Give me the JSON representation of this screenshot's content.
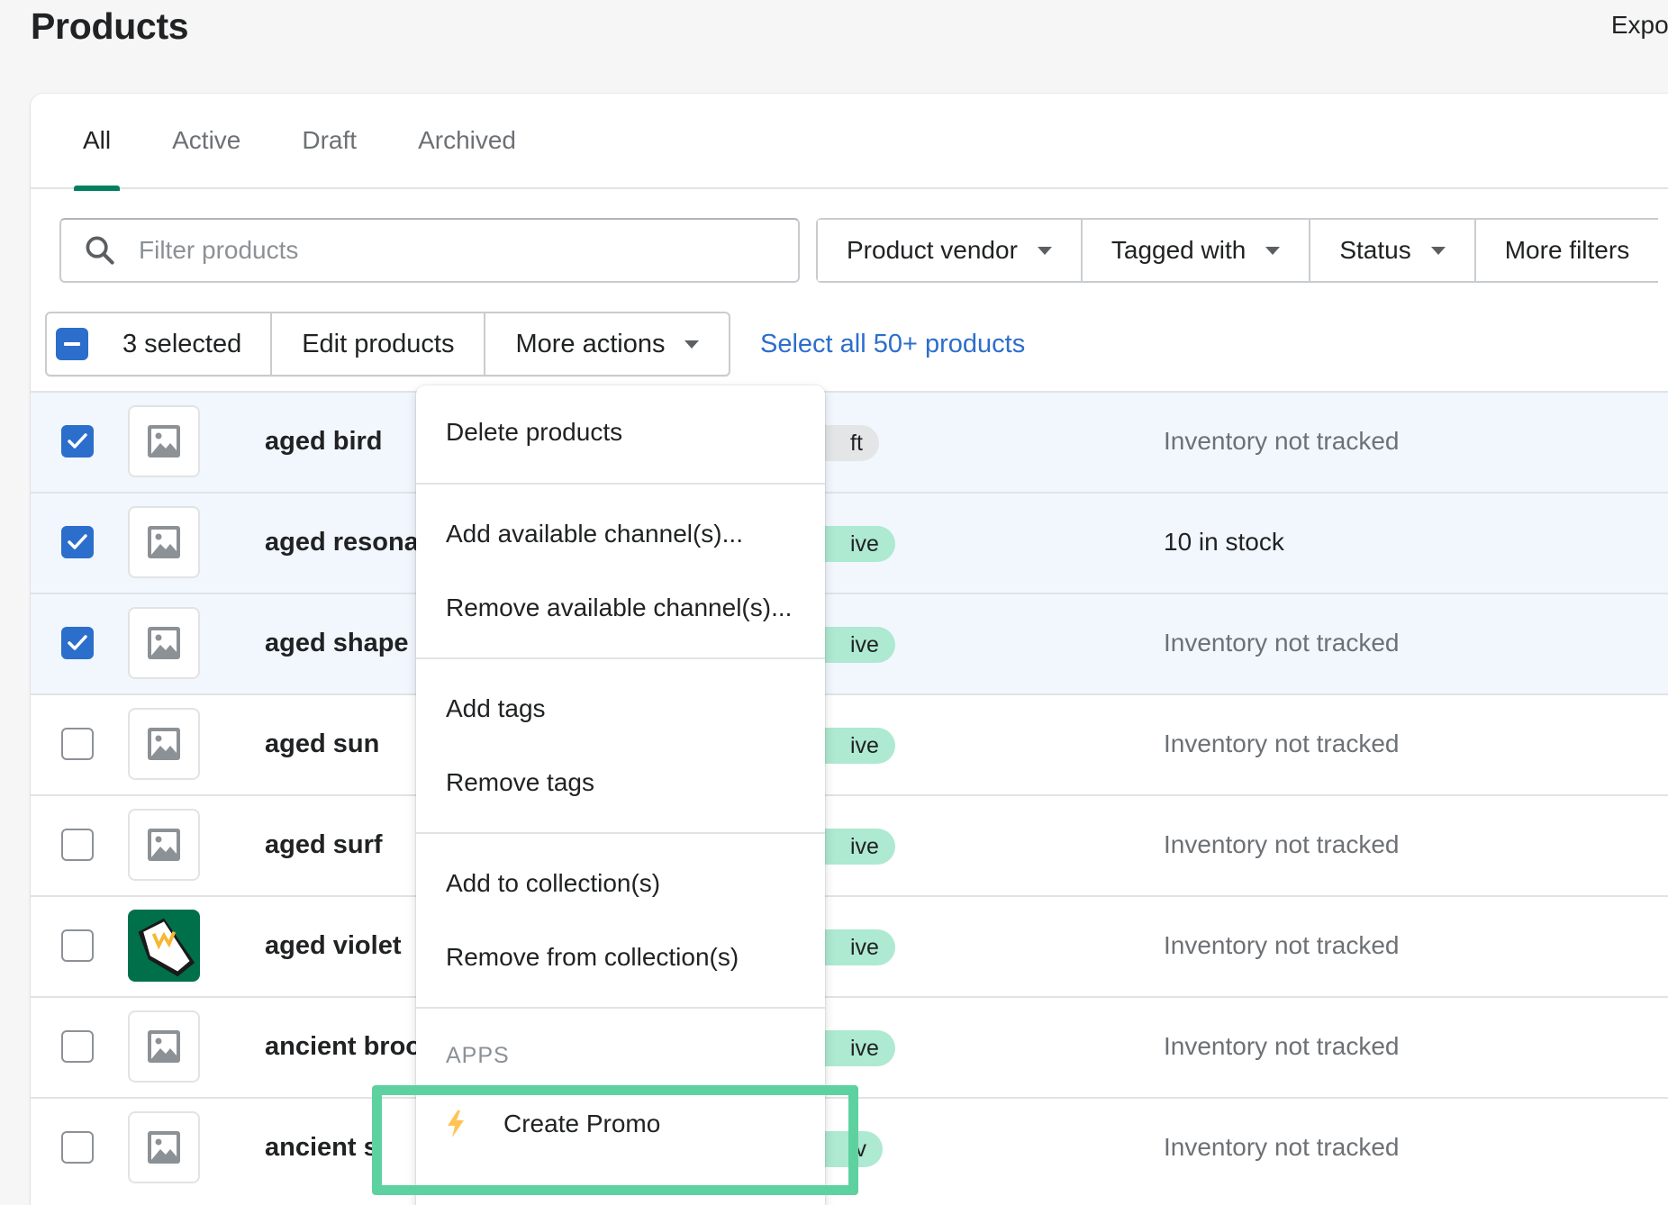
{
  "page": {
    "title": "Products",
    "export_label": "Expor"
  },
  "tabs": [
    {
      "label": "All",
      "active": true
    },
    {
      "label": "Active",
      "active": false
    },
    {
      "label": "Draft",
      "active": false
    },
    {
      "label": "Archived",
      "active": false
    }
  ],
  "search": {
    "placeholder": "Filter products",
    "value": "",
    "icon": "search-icon"
  },
  "filters": [
    {
      "label": "Product vendor"
    },
    {
      "label": "Tagged with"
    },
    {
      "label": "Status"
    },
    {
      "label": "More filters"
    }
  ],
  "bulk": {
    "selected_label": "3 selected",
    "edit_label": "Edit products",
    "more_actions_label": "More actions",
    "select_all_label": "Select all 50+ products"
  },
  "rows": [
    {
      "name": "aged bird",
      "selected": true,
      "status": "ft",
      "status_type": "draft",
      "inventory": "Inventory not tracked",
      "image": "placeholder"
    },
    {
      "name": "aged resona",
      "selected": true,
      "status": "ive",
      "status_type": "active",
      "inventory": "10 in stock",
      "image": "placeholder"
    },
    {
      "name": "aged shape",
      "selected": true,
      "status": "ive",
      "status_type": "active",
      "inventory": "Inventory not tracked",
      "image": "placeholder"
    },
    {
      "name": "aged sun",
      "selected": false,
      "status": "ive",
      "status_type": "active",
      "inventory": "Inventory not tracked",
      "image": "placeholder"
    },
    {
      "name": "aged surf",
      "selected": false,
      "status": "ive",
      "status_type": "active",
      "inventory": "Inventory not tracked",
      "image": "placeholder"
    },
    {
      "name": "aged violet",
      "selected": false,
      "status": "ive",
      "status_type": "active",
      "inventory": "Inventory not tracked",
      "image": "brand-logo"
    },
    {
      "name": "ancient broo",
      "selected": false,
      "status": "ive",
      "status_type": "active",
      "inventory": "Inventory not tracked",
      "image": "placeholder"
    },
    {
      "name": "ancient s",
      "selected": false,
      "status": "iv",
      "status_type": "active",
      "inventory": "Inventory not tracked",
      "image": "placeholder"
    }
  ],
  "menu": {
    "sections": [
      [
        "Delete products"
      ],
      [
        "Add available channel(s)...",
        "Remove available channel(s)..."
      ],
      [
        "Add tags",
        "Remove tags"
      ],
      [
        "Add to collection(s)",
        "Remove from collection(s)"
      ]
    ],
    "apps_heading": "APPS",
    "app_item": {
      "label": "Create Promo",
      "icon": "bolt-icon"
    }
  },
  "colors": {
    "accent": "#008060",
    "primary_blue": "#2c6ecb",
    "active_badge": "#aee9d1",
    "highlight": "#5dd2a0",
    "bolt": "#ffc453"
  }
}
